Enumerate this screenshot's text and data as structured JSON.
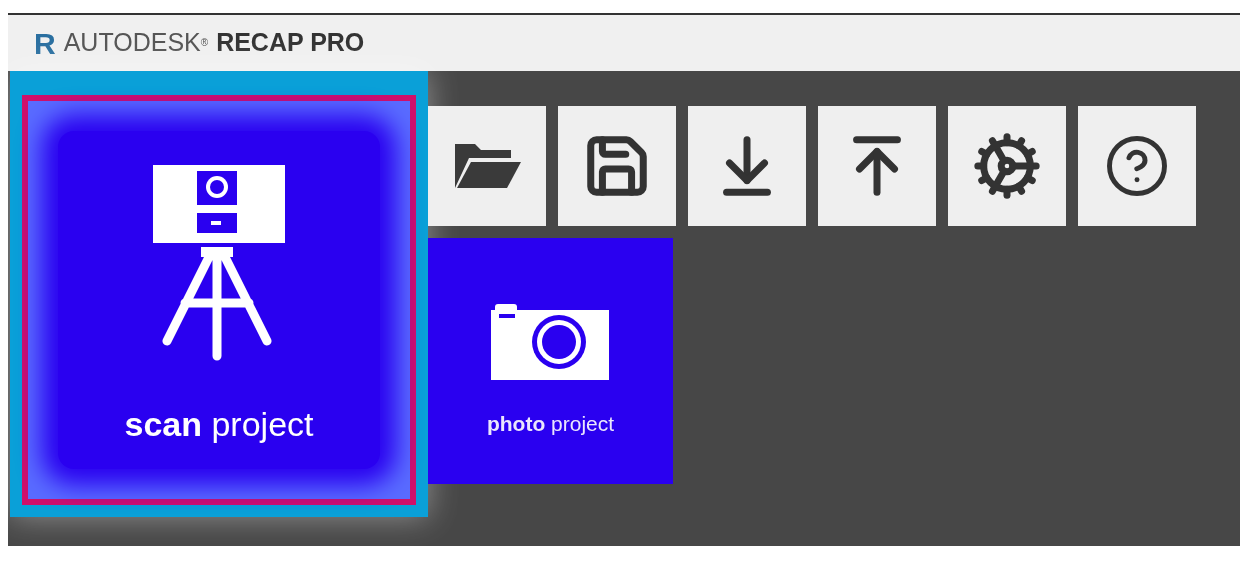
{
  "title_bar": {
    "logo": "R",
    "brand": "AUTODESK",
    "brand_mark": "®",
    "product": "RECAP PRO"
  },
  "project_tiles": [
    {
      "kind": "scan",
      "label": "**scan** project",
      "selected": true
    },
    {
      "kind": "photo",
      "label": "**photo** project",
      "selected": false
    }
  ],
  "toolbar": [
    {
      "kind": "open"
    },
    {
      "kind": "save"
    },
    {
      "kind": "download"
    },
    {
      "kind": "upload"
    },
    {
      "kind": "settings"
    },
    {
      "kind": "help"
    }
  ]
}
